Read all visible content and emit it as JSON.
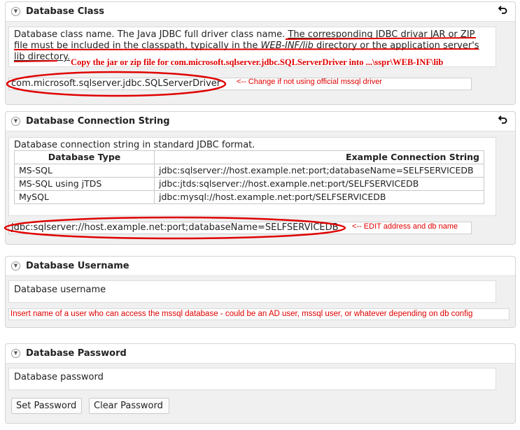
{
  "db_class": {
    "title": "Database Class",
    "desc_a": "Database class name. The Java JDBC full driver class name.",
    "desc_b": "The corresponding JDBC drivar JAR or ZIP file must be included in the classpath, typically in the",
    "desc_c": "WEB-INF/lib",
    "desc_d": "directory or the application server's lib directory.",
    "copy_note": "Copy the  jar or zip file for com.microsoft.sqlserver.jdbc.SQLServerDriver into ...\\sspr\\WEB-INF\\lib",
    "value": "com.microsoft.sqlserver.jdbc.SQLServerDriver",
    "annotation": "<-- Change if not using official mssql driver"
  },
  "db_conn": {
    "title": "Database Connection String",
    "desc": "Database connection string in standard JDBC format.",
    "table_headers": [
      "Database Type",
      "Example Connection String"
    ],
    "rows": [
      [
        "MS-SQL",
        "jdbc:sqlserver://host.example.net:port;databaseName=SELFSERVICEDB"
      ],
      [
        "MS-SQL using jTDS",
        "jdbc:jtds:sqlserver://host.example.net:port/SELFSERVICEDB"
      ],
      [
        "MySQL",
        "jdbc:mysql://host.example.net:port/SELFSERVICEDB"
      ]
    ],
    "value": "jdbc:sqlserver://host.example.net:port;databaseName=SELFSERVICEDB",
    "annotation": "<-- EDIT address and db name"
  },
  "db_user": {
    "title": "Database Username",
    "desc": "Database username",
    "annotation": "Insert name of a user who can access the mssql database - could be an AD user, mssql user, or whatever depending on db config"
  },
  "db_pass": {
    "title": "Database Password",
    "desc": "Database password",
    "set_label": "Set Password",
    "clear_label": "Clear Password"
  },
  "icons": {
    "collapse": "collapse-circle-icon",
    "undo": "undo-arrow-icon"
  },
  "colors": {
    "annotation_red": "#e00000",
    "panel_bg": "#f0f0f0"
  }
}
